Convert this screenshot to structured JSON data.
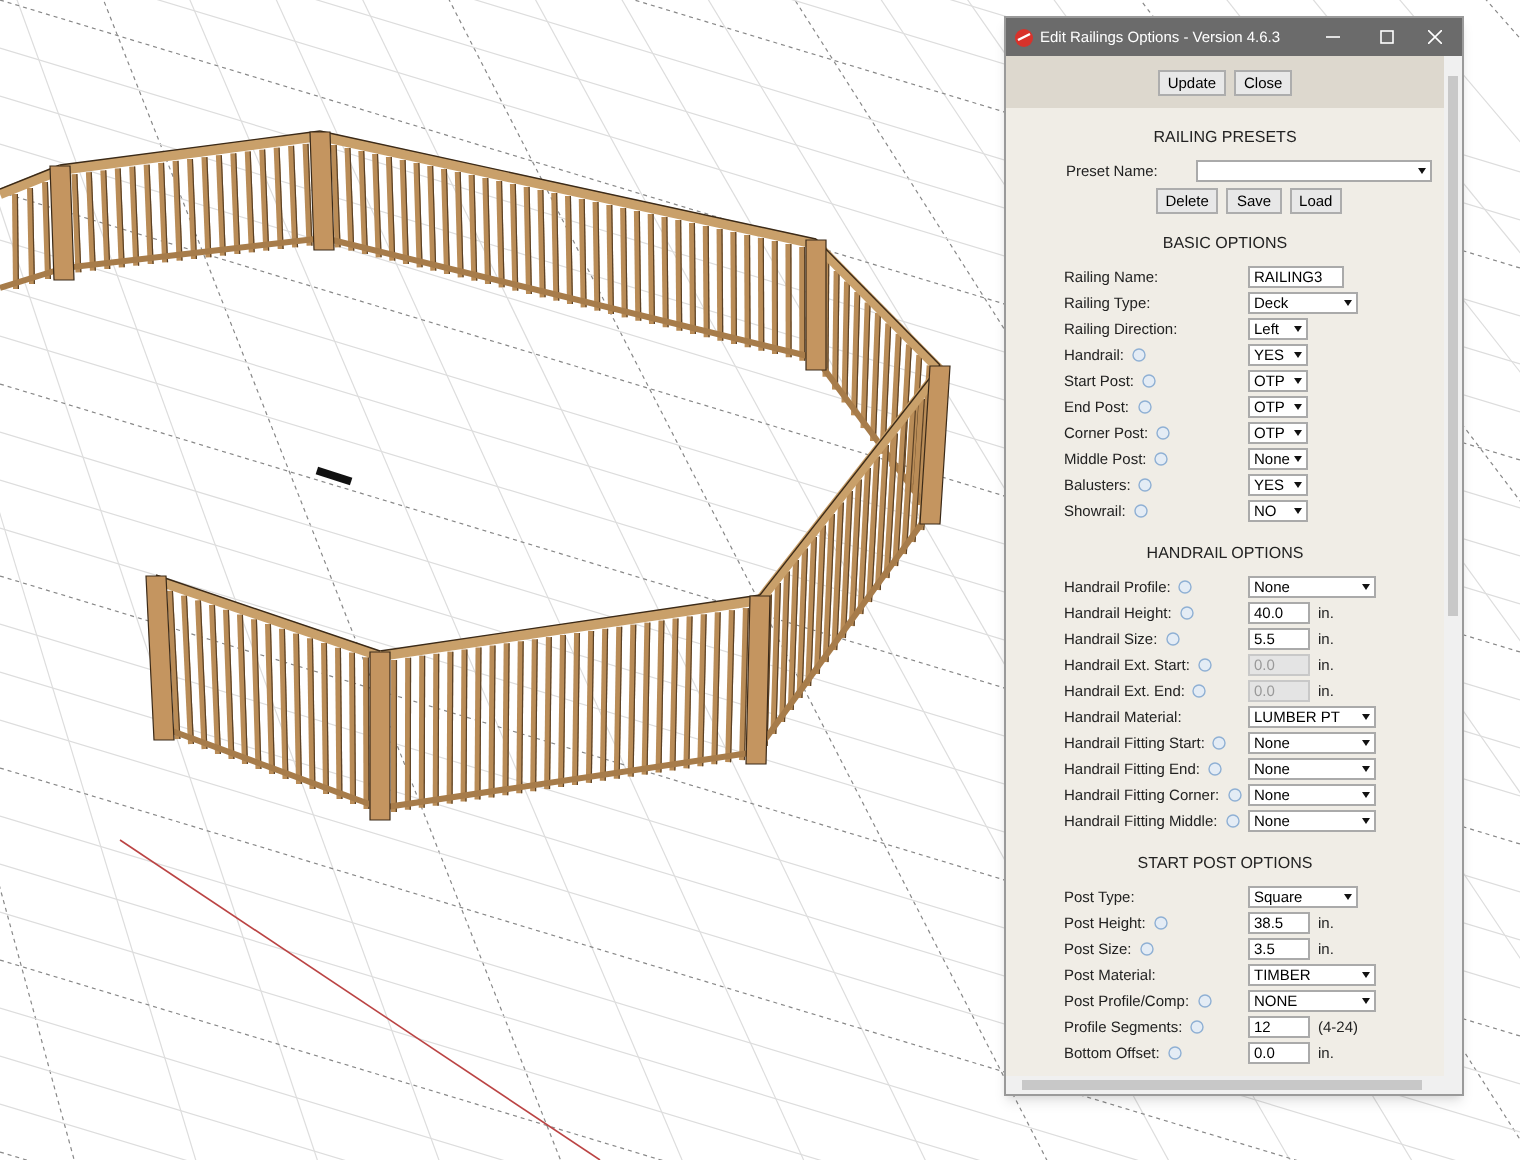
{
  "window": {
    "title": "Edit Railings Options - Version 4.6.3"
  },
  "toolbar": {
    "buttons": [
      "Update",
      "Close"
    ]
  },
  "presets": {
    "heading": "RAILING PRESETS",
    "label": "Preset Name:",
    "buttons": [
      "Delete",
      "Save",
      "Load"
    ]
  },
  "sections": [
    {
      "heading": "BASIC OPTIONS",
      "rows": [
        {
          "label": "Railing Name:",
          "help": false,
          "kind": "text",
          "value": "RAILING3",
          "disabled": false
        },
        {
          "label": "Railing Type:",
          "help": false,
          "kind": "select-medium",
          "value": "Deck",
          "disabled": false
        },
        {
          "label": "Railing Direction:",
          "help": false,
          "kind": "select-small",
          "value": "Left",
          "disabled": false
        },
        {
          "label": "Handrail:",
          "help": true,
          "kind": "select-small",
          "value": "YES",
          "disabled": false
        },
        {
          "label": "Start Post:",
          "help": true,
          "kind": "select-small",
          "value": "OTP",
          "disabled": false
        },
        {
          "label": "End Post:",
          "help": true,
          "kind": "select-small",
          "value": "OTP",
          "disabled": false
        },
        {
          "label": "Corner Post:",
          "help": true,
          "kind": "select-small",
          "value": "OTP",
          "disabled": false
        },
        {
          "label": "Middle Post:",
          "help": true,
          "kind": "select-small",
          "value": "None",
          "disabled": false
        },
        {
          "label": "Balusters:",
          "help": true,
          "kind": "select-small",
          "value": "YES",
          "disabled": false
        },
        {
          "label": "Showrail:",
          "help": true,
          "kind": "select-small",
          "value": "NO",
          "disabled": false
        }
      ]
    },
    {
      "heading": "HANDRAIL OPTIONS",
      "rows": [
        {
          "label": "Handrail Profile:",
          "help": true,
          "kind": "select-large",
          "value": "None",
          "disabled": false
        },
        {
          "label": "Handrail Height:",
          "help": true,
          "kind": "text",
          "value": "40.0",
          "unit": "in.",
          "disabled": false
        },
        {
          "label": "Handrail Size:",
          "help": true,
          "kind": "text",
          "value": "5.5",
          "unit": "in.",
          "disabled": false
        },
        {
          "label": "Handrail Ext. Start:",
          "help": true,
          "kind": "text",
          "value": "0.0",
          "unit": "in.",
          "disabled": true
        },
        {
          "label": "Handrail Ext. End:",
          "help": true,
          "kind": "text",
          "value": "0.0",
          "unit": "in.",
          "disabled": true
        },
        {
          "label": "Handrail Material:",
          "help": false,
          "kind": "select-large",
          "value": "LUMBER PT",
          "disabled": false
        },
        {
          "label": "Handrail Fitting Start:",
          "help": true,
          "kind": "select-large",
          "value": "None",
          "disabled": false
        },
        {
          "label": "Handrail Fitting End:",
          "help": true,
          "kind": "select-large",
          "value": "None",
          "disabled": false
        },
        {
          "label": "Handrail Fitting Corner:",
          "help": true,
          "kind": "select-large",
          "value": "None",
          "disabled": false
        },
        {
          "label": "Handrail Fitting Middle:",
          "help": true,
          "kind": "select-large",
          "value": "None",
          "disabled": false
        }
      ]
    },
    {
      "heading": "START POST OPTIONS",
      "rows": [
        {
          "label": "Post Type:",
          "help": false,
          "kind": "select-medium",
          "value": "Square",
          "disabled": false
        },
        {
          "label": "Post Height:",
          "help": true,
          "kind": "text",
          "value": "38.5",
          "unit": "in.",
          "disabled": false
        },
        {
          "label": "Post Size:",
          "help": true,
          "kind": "text",
          "value": "3.5",
          "unit": "in.",
          "disabled": false
        },
        {
          "label": "Post Material:",
          "help": false,
          "kind": "select-large",
          "value": "TIMBER",
          "disabled": false
        },
        {
          "label": "Post Profile/Comp:",
          "help": true,
          "kind": "select-large",
          "value": "NONE",
          "disabled": false
        },
        {
          "label": "Profile Segments:",
          "help": true,
          "kind": "text",
          "value": "12",
          "unit": "(4-24)",
          "disabled": false
        },
        {
          "label": "Bottom Offset:",
          "help": true,
          "kind": "text",
          "value": "0.0",
          "unit": "in.",
          "disabled": false
        }
      ]
    }
  ]
}
